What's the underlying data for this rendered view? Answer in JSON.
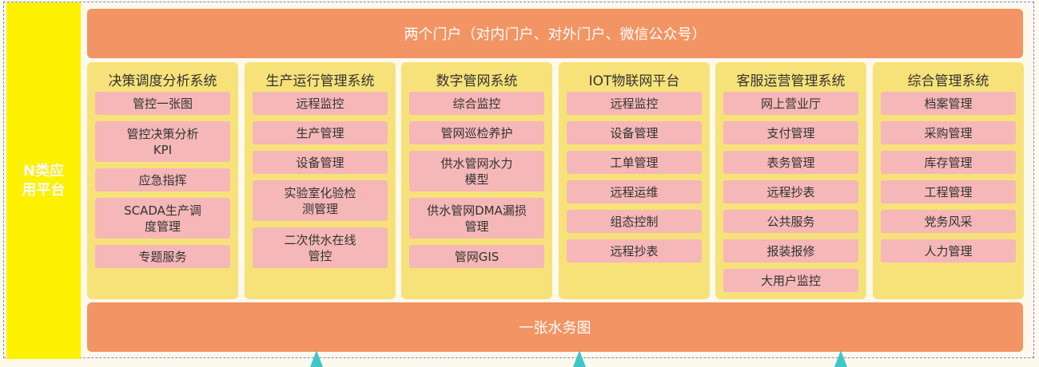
{
  "platform_label": "N类应用平台",
  "top_band": "两个门户（对内门户、对外门户、微信公众号）",
  "bottom_band": "一张水务图",
  "columns": [
    {
      "title": "决策调度分析系统",
      "items": [
        "管控一张图",
        "管控决策分析\nKPI",
        "应急指挥",
        "SCADA生产调\n度管理",
        "专题服务"
      ]
    },
    {
      "title": "生产运行管理系统",
      "items": [
        "远程监控",
        "生产管理",
        "设备管理",
        "实验室化验检\n测管理",
        "二次供水在线\n管控"
      ]
    },
    {
      "title": "数字管网系统",
      "items": [
        "综合监控",
        "管网巡检养护",
        "供水管网水力\n模型",
        "供水管网DMA漏损\n管理",
        "管网GIS"
      ]
    },
    {
      "title": "IOT物联网平台",
      "items": [
        "远程监控",
        "设备管理",
        "工单管理",
        "远程运维",
        "组态控制",
        "远程抄表"
      ]
    },
    {
      "title": "客服运营管理系统",
      "items": [
        "网上营业厅",
        "支付管理",
        "表务管理",
        "远程抄表",
        "公共服务",
        "报装报修",
        "大用户监控"
      ]
    },
    {
      "title": "综合管理系统",
      "items": [
        "档案管理",
        "采购管理",
        "库存管理",
        "工程管理",
        "党务风采",
        "人力管理"
      ]
    }
  ],
  "colors": {
    "band": "#f29463",
    "column": "#f7e27a",
    "item": "#f5b7b7",
    "platform": "#fff200",
    "arrow": "#3fc7c7"
  }
}
